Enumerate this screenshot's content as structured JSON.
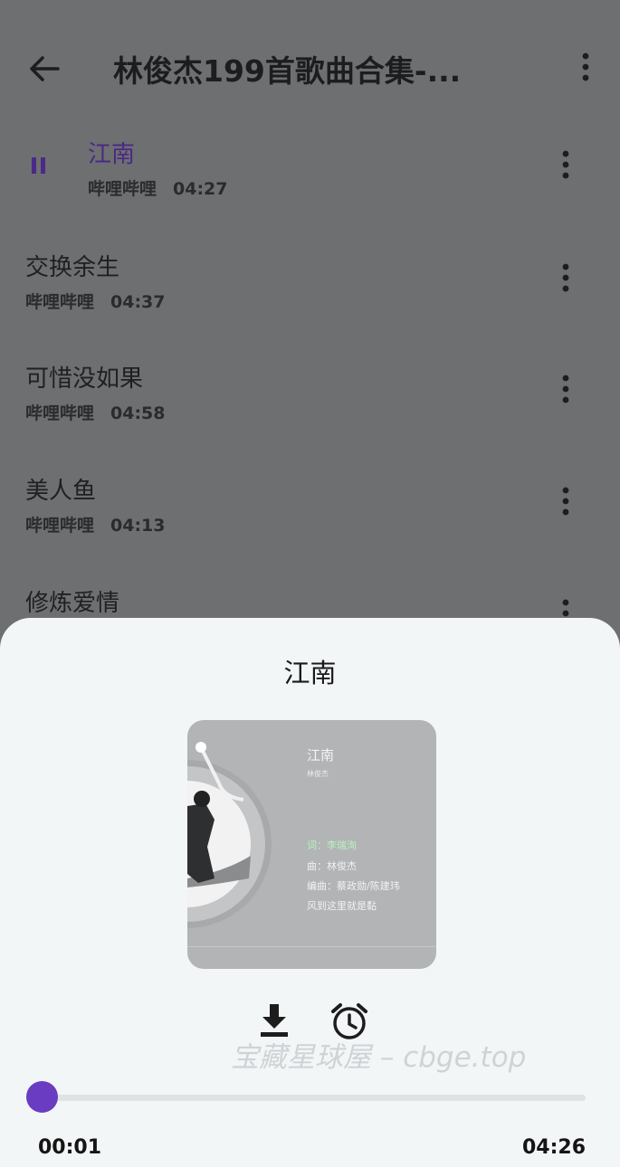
{
  "header": {
    "title": "林俊杰199首歌曲合集-..."
  },
  "songs": [
    {
      "name": "江南",
      "source": "哔哩哔哩",
      "duration": "04:27",
      "playing": true
    },
    {
      "name": "交换余生",
      "source": "哔哩哔哩",
      "duration": "04:37"
    },
    {
      "name": "可惜没如果",
      "source": "哔哩哔哩",
      "duration": "04:58"
    },
    {
      "name": "美人鱼",
      "source": "哔哩哔哩",
      "duration": "04:13"
    },
    {
      "name": "修炼爱情",
      "source": "",
      "duration": ""
    }
  ],
  "player": {
    "title": "江南",
    "cover": {
      "song": "江南",
      "artist": "林俊杰",
      "lyrics": [
        "词：李瑞洵",
        "曲：林俊杰",
        "编曲：蔡政勋/陈建玮",
        "风到这里就是黏"
      ]
    },
    "watermark": "宝藏星球屋 – cbge.top",
    "progress": 0.004,
    "elapsed": "00:01",
    "total": "04:26"
  },
  "colors": {
    "accent": "#6a3cc2",
    "current_song": "#4a2a86",
    "sheet_bg": "#f3f6f7",
    "overlay": "#6e6f70"
  },
  "icons": [
    "back-arrow-icon",
    "more-vert-icon",
    "pause-icon",
    "download-icon",
    "alarm-clock-icon"
  ]
}
